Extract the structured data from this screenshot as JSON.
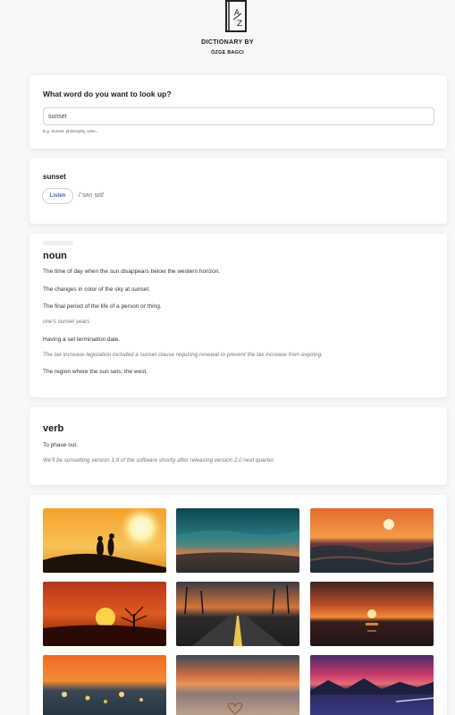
{
  "brand": {
    "line1": "DICTIONARY BY",
    "line2": "ÖZGE BAGCI",
    "logo_icon": "book-az-icon"
  },
  "search": {
    "question": "What word do you want to look up?",
    "value": "sunset",
    "hint": "E.g. Sunset, philosophy, wine..."
  },
  "word": {
    "text": "sunset",
    "listen_label": "Listen",
    "phonetic": "/ˈsʌnˌsɛt/"
  },
  "noun": {
    "part_of_speech": "noun",
    "defs": [
      "The time of day when the sun disappears below the western horizon.",
      "The changes in color of the sky at sunset.",
      "The final period of the life of a person or thing.",
      "Having a set termination date.",
      "The region where the sun sets; the west."
    ],
    "examples": [
      "one's sunset years",
      "The tax increase legislation included a sunset clause requiring renewal to prevent the tax increase from expiring."
    ]
  },
  "verb": {
    "part_of_speech": "verb",
    "def": "To phase out.",
    "example": "We'll be sunsetting version 1.9 of the software shortly after releasing version 2.0 next quarter."
  },
  "gallery": {
    "photos": [
      "sunset-couple-photo",
      "teal-sky-sunset-photo",
      "ocean-waves-sunset-photo",
      "tree-sunset-photo",
      "palm-road-sunset-photo",
      "sea-horizon-sunset-photo",
      "sparkling-sea-sunset-photo",
      "beach-heart-sunset-photo",
      "purple-lake-sunset-photo"
    ]
  }
}
